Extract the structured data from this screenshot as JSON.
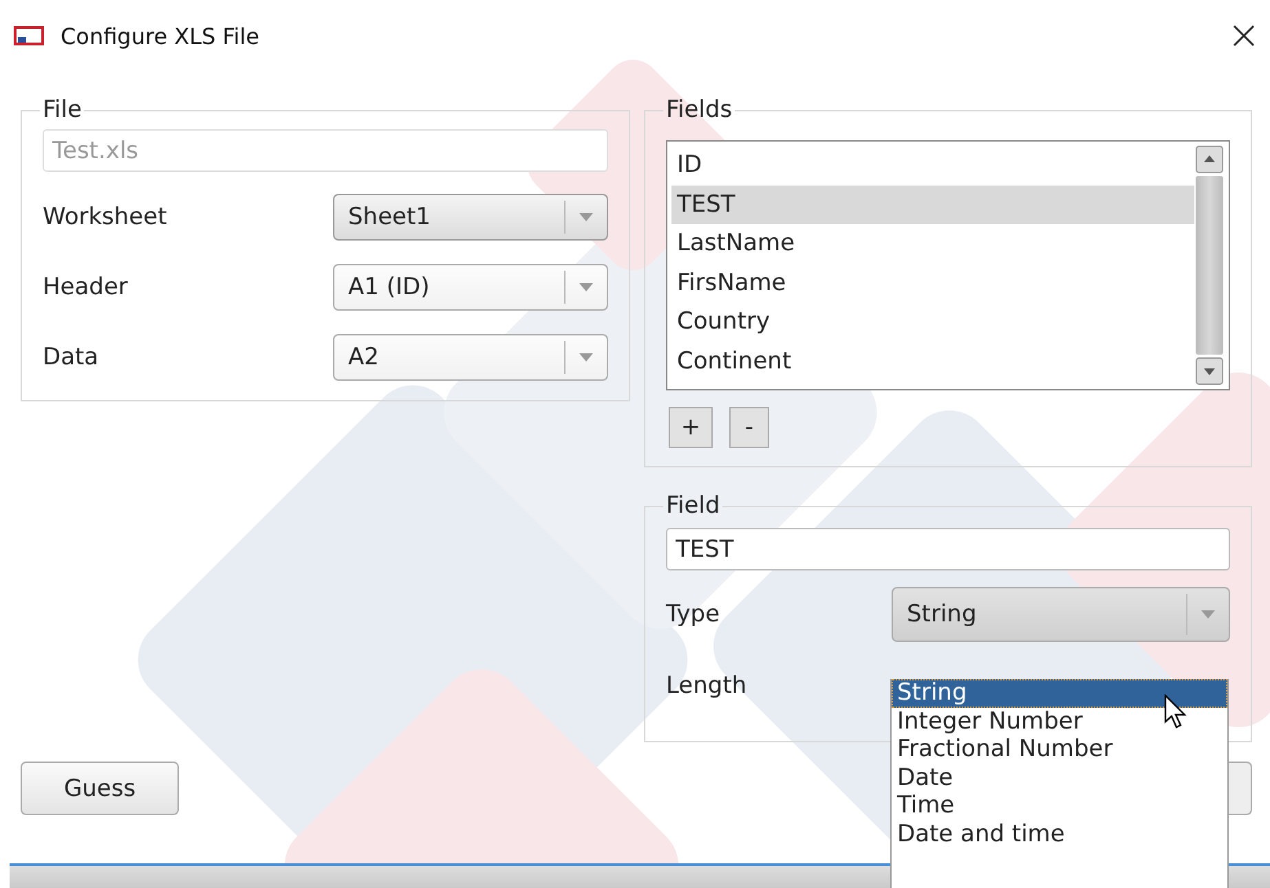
{
  "window": {
    "title": "Configure XLS File"
  },
  "file_group": {
    "title": "File",
    "path": {
      "value": "Test.xls",
      "disabled": true
    },
    "rows": [
      {
        "label": "Worksheet",
        "value": "Sheet1",
        "hovered": true
      },
      {
        "label": "Header",
        "value": "A1 (ID)",
        "hovered": false
      },
      {
        "label": "Data",
        "value": "A2",
        "hovered": false
      }
    ]
  },
  "fields_group": {
    "title": "Fields",
    "items": [
      {
        "label": "ID",
        "selected": false
      },
      {
        "label": "TEST",
        "selected": true
      },
      {
        "label": "LastName",
        "selected": false
      },
      {
        "label": "FirsName",
        "selected": false
      },
      {
        "label": "Country",
        "selected": false
      },
      {
        "label": "Continent",
        "selected": false
      }
    ],
    "buttons": [
      "+",
      "-"
    ]
  },
  "field_group": {
    "title": "Field",
    "name": {
      "value": "TEST"
    },
    "type": {
      "label": "Type",
      "value": "String"
    },
    "length": {
      "label": "Length"
    },
    "type_options": [
      {
        "label": "String",
        "selected": true
      },
      {
        "label": "Integer Number",
        "selected": false
      },
      {
        "label": "Fractional Number",
        "selected": false
      },
      {
        "label": "Date",
        "selected": false
      },
      {
        "label": "Time",
        "selected": false
      },
      {
        "label": "Date and time",
        "selected": false
      }
    ]
  },
  "buttons": [
    "Guess"
  ]
}
